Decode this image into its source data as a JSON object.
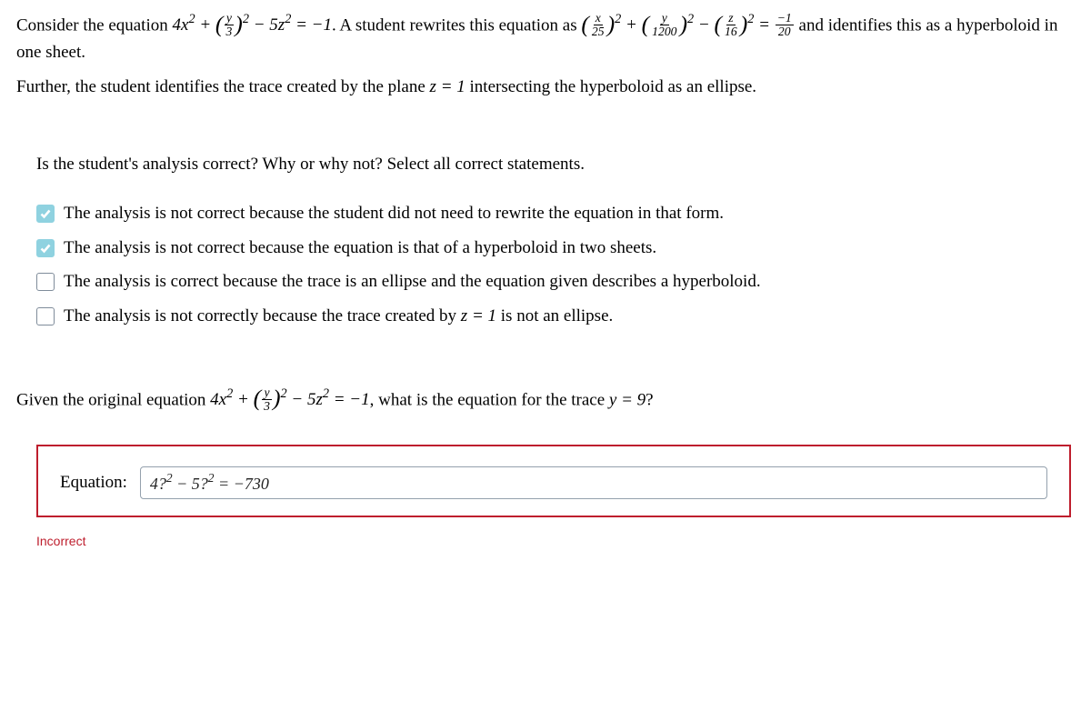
{
  "problem": {
    "line1_a": "Consider the equation ",
    "eq1_lhs": "4x² + (y/3)² − 5z² = −1",
    "line1_b": ". A student rewrites this equation as ",
    "eq1_rewrite": "(x/25)² + (y/1200)² − (z/16)² = −1/20",
    "line1_c": " and identifies this as a hyperboloid in one sheet.",
    "line2_a": "Further, the student identifies the trace created by the plane ",
    "line2_eq": "z = 1",
    "line2_b": " intersecting the hyperboloid as an ellipse."
  },
  "question": "Is the student's analysis correct?  Why or why not?  Select all correct statements.",
  "options": [
    {
      "checked": true,
      "text": "The analysis is not correct because the student did not need to rewrite the equation in that form."
    },
    {
      "checked": true,
      "text": "The analysis is not correct because the equation is that of a hyperboloid in two sheets."
    },
    {
      "checked": false,
      "text": "The analysis is correct because the trace is an ellipse and the equation given describes a hyperboloid."
    },
    {
      "checked": false,
      "text": "The analysis is not correctly because the trace created by z = 1 is not an ellipse."
    }
  ],
  "followup": {
    "a": "Given the original equation ",
    "eq": "4x² + (y/3)² − 5z² = −1",
    "b": ", what is the equation for the trace ",
    "cond": "y = 9",
    "c": "?"
  },
  "answer": {
    "label": "Equation:",
    "value": "4?² − 5?² = −730"
  },
  "status": "Incorrect"
}
